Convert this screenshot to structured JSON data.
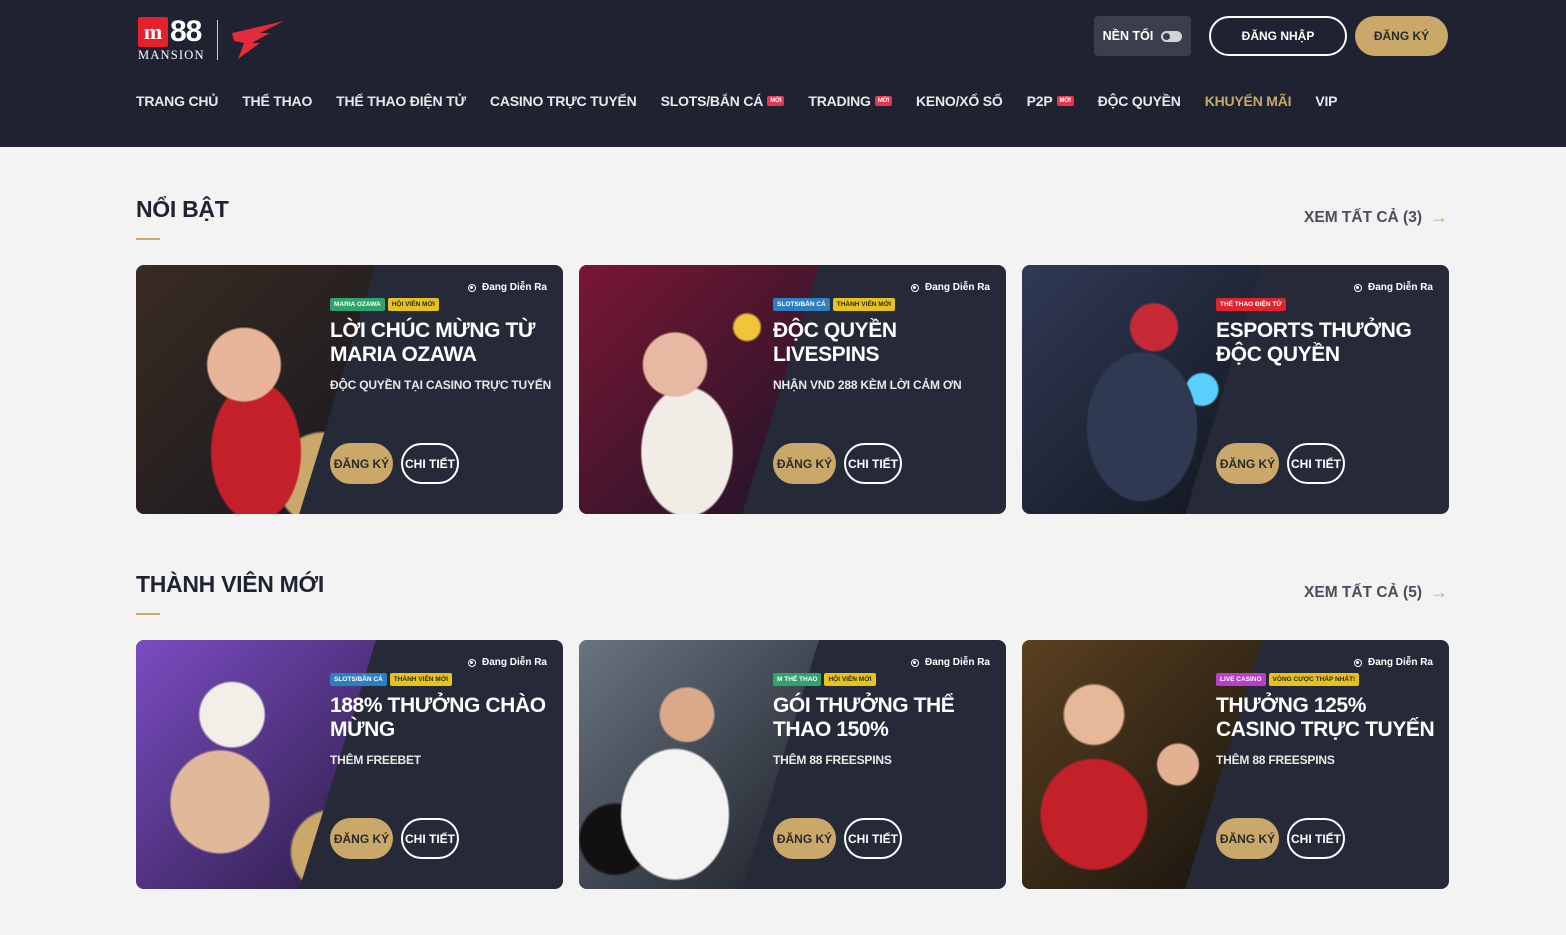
{
  "header": {
    "logo": {
      "mark": "m",
      "number": "88",
      "word": "MANSION"
    },
    "dark_mode_label": "NỀN TỐI",
    "login_label": "ĐĂNG NHẬP",
    "register_label": "ĐĂNG KÝ"
  },
  "nav": [
    {
      "label": "TRANG CHỦ"
    },
    {
      "label": "THỂ THAO"
    },
    {
      "label": "THỂ THAO ĐIỆN TỬ"
    },
    {
      "label": "CASINO TRỰC TUYẾN"
    },
    {
      "label": "SLOTS/BẮN CÁ",
      "badge": "MỚI"
    },
    {
      "label": "TRADING",
      "badge": "MỚI"
    },
    {
      "label": "KENO/XỔ SỐ"
    },
    {
      "label": "P2P",
      "badge": "MỚI"
    },
    {
      "label": "ĐỘC QUYỀN"
    },
    {
      "label": "KHUYẾN MÃI",
      "active": true
    },
    {
      "label": "VIP"
    }
  ],
  "sections": [
    {
      "title": "NỔI BẬT",
      "see_all": "XEM TẤT CẢ (3)",
      "cards": [
        {
          "status": "Đang Diễn Ra",
          "tags": [
            {
              "text": "MARIA OZAWA",
              "color": "#2fa36b"
            },
            {
              "text": "HỘI VIÊN MỚI",
              "color": "#e6c21e"
            }
          ],
          "title": "LỜI CHÚC MỪNG TỪ MARIA OZAWA",
          "subtitle": "ĐỘC QUYỀN TẠI CASINO TRỰC TUYẾN",
          "register": "ĐĂNG KÝ",
          "details": "CHI TIẾT"
        },
        {
          "status": "Đang Diễn Ra",
          "tags": [
            {
              "text": "SLOTS/BẮN CÁ",
              "color": "#2e7fc1"
            },
            {
              "text": "THÀNH VIÊN MỚI",
              "color": "#e6c21e"
            }
          ],
          "title": "ĐỘC QUYỀN LIVESPINS",
          "subtitle": "NHẬN VND 288 KÈM LỜI CẢM ƠN",
          "register": "ĐĂNG KÝ",
          "details": "CHI TIẾT"
        },
        {
          "status": "Đang Diễn Ra",
          "tags": [
            {
              "text": "THỂ THAO ĐIỆN TỬ",
              "color": "#e0232f"
            }
          ],
          "title": "ESPORTS THƯỞNG ĐỘC QUYỀN",
          "subtitle": "",
          "register": "ĐĂNG KÝ",
          "details": "CHI TIẾT"
        }
      ]
    },
    {
      "title": "THÀNH VIÊN MỚI",
      "see_all": "XEM TẤT CẢ (5)",
      "cards": [
        {
          "status": "Đang Diễn Ra",
          "tags": [
            {
              "text": "SLOTS/BẮN CÁ",
              "color": "#2e7fc1"
            },
            {
              "text": "THÀNH VIÊN MỚI",
              "color": "#e6c21e"
            }
          ],
          "title": "188% THƯỞNG CHÀO MỪNG",
          "subtitle": "THÊM FREEBET",
          "register": "ĐĂNG KÝ",
          "details": "CHI TIẾT"
        },
        {
          "status": "Đang Diễn Ra",
          "tags": [
            {
              "text": "M THỂ THAO",
              "color": "#2fa36b"
            },
            {
              "text": "HỘI VIÊN MỚI",
              "color": "#e6c21e"
            }
          ],
          "title": "GÓI THƯỞNG THỂ THAO 150%",
          "subtitle": "THÊM 88 FREESPINS",
          "register": "ĐĂNG KÝ",
          "details": "CHI TIẾT"
        },
        {
          "status": "Đang Diễn Ra",
          "tags": [
            {
              "text": "LIVE CASINO",
              "color": "#b73fc9"
            },
            {
              "text": "VÒNG CƯỢC THẤP NHẤT!",
              "color": "#e6c21e"
            }
          ],
          "title": "THƯỞNG 125% CASINO TRỰC TUYẾN",
          "subtitle": "THÊM 88 FREESPINS",
          "register": "ĐĂNG KÝ",
          "details": "CHI TIẾT"
        }
      ]
    }
  ],
  "colors": {
    "header_bg": "#1f2230",
    "accent_gold": "#c9a86a",
    "card_bg": "#262a38",
    "page_bg": "#f3f3f3"
  }
}
